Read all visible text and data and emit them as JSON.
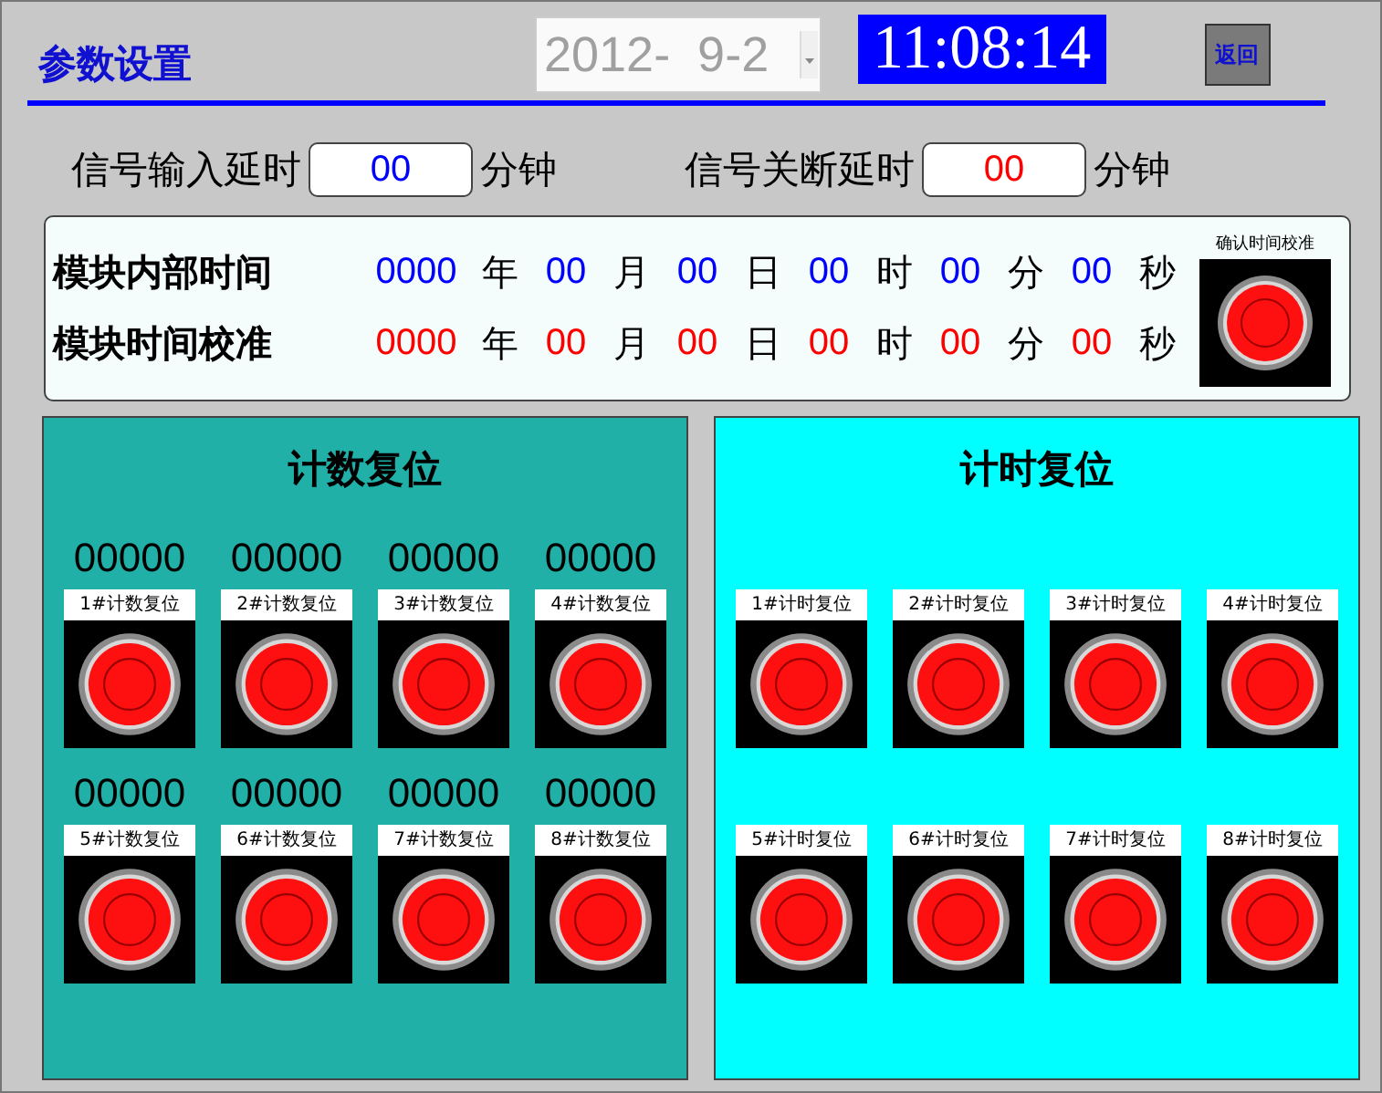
{
  "header": {
    "title": "参数设置",
    "date": "2012-  9-2",
    "time": "11:08:14",
    "back_button": "返回"
  },
  "delays": [
    {
      "label": "信号输入延时",
      "value": "00",
      "unit": "分钟",
      "color": "#0000ff"
    },
    {
      "label": "信号关断延时",
      "value": "00",
      "unit": "分钟",
      "color": "#ff0000"
    }
  ],
  "time_panel": {
    "rows": [
      {
        "label": "模块内部时间",
        "color": "#0000ff",
        "fields": [
          {
            "value": "0000",
            "unit": "年"
          },
          {
            "value": "00",
            "unit": "月"
          },
          {
            "value": "00",
            "unit": "日"
          },
          {
            "value": "00",
            "unit": "时"
          },
          {
            "value": "00",
            "unit": "分"
          },
          {
            "value": "00",
            "unit": "秒"
          }
        ]
      },
      {
        "label": "模块时间校准",
        "color": "#ff0000",
        "fields": [
          {
            "value": "0000",
            "unit": "年"
          },
          {
            "value": "00",
            "unit": "月"
          },
          {
            "value": "00",
            "unit": "日"
          },
          {
            "value": "00",
            "unit": "时"
          },
          {
            "value": "00",
            "unit": "分"
          },
          {
            "value": "00",
            "unit": "秒"
          }
        ]
      }
    ],
    "confirm_button": "确认时间校准"
  },
  "count_panel": {
    "title": "计数复位",
    "items": [
      {
        "count": "00000",
        "label": "1#计数复位"
      },
      {
        "count": "00000",
        "label": "2#计数复位"
      },
      {
        "count": "00000",
        "label": "3#计数复位"
      },
      {
        "count": "00000",
        "label": "4#计数复位"
      },
      {
        "count": "00000",
        "label": "5#计数复位"
      },
      {
        "count": "00000",
        "label": "6#计数复位"
      },
      {
        "count": "00000",
        "label": "7#计数复位"
      },
      {
        "count": "00000",
        "label": "8#计数复位"
      }
    ]
  },
  "time_reset_panel": {
    "title": "计时复位",
    "items": [
      {
        "label": "1#计时复位"
      },
      {
        "label": "2#计时复位"
      },
      {
        "label": "3#计时复位"
      },
      {
        "label": "4#计时复位"
      },
      {
        "label": "5#计时复位"
      },
      {
        "label": "6#计时复位"
      },
      {
        "label": "7#计时复位"
      },
      {
        "label": "8#计时复位"
      }
    ]
  }
}
